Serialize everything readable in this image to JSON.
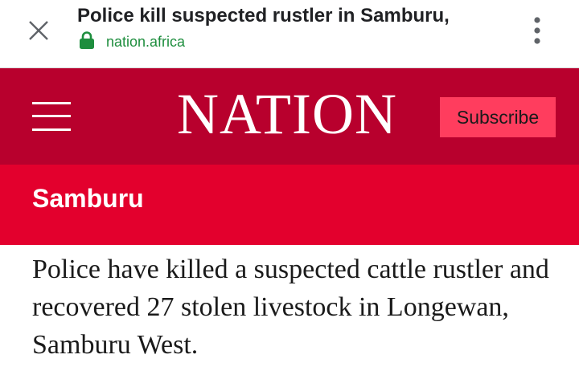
{
  "browser": {
    "title": "Police kill suspected rustler in Samburu,",
    "url": "nation.africa",
    "icons": {
      "close": "close-icon",
      "lock": "lock-icon",
      "menu": "more-vert-icon"
    },
    "colors": {
      "secure_green": "#1e8e3e"
    }
  },
  "site": {
    "logo": "NATION",
    "subscribe_label": "Subscribe",
    "icons": {
      "menu": "hamburger-menu-icon"
    },
    "colors": {
      "header_bg": "#b8002d",
      "subscribe_bg": "#ff3d5e",
      "section_bg": "#e3002d"
    }
  },
  "section": {
    "label": "Samburu"
  },
  "article": {
    "summary": "Police have killed a suspected cattle rustler and recovered 27 stolen livestock in Longewan, Samburu West."
  }
}
